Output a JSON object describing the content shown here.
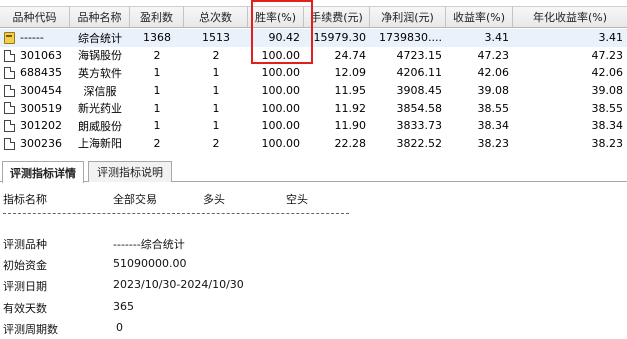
{
  "table": {
    "headers": [
      "品种代码",
      "品种名称",
      "盈利数",
      "总次数",
      "胜率(%)",
      "手续费(元)",
      "净利润(元)",
      "收益率(%)",
      "年化收益率(%)"
    ],
    "rows": [
      {
        "code": "------",
        "name": "综合统计",
        "profit_count": "1368",
        "total_count": "1513",
        "win_rate": "90.42",
        "fee": "15979.30",
        "net_profit": "1739830....",
        "return_rate": "3.41",
        "annual_return": "3.41",
        "icon": "folder-icon"
      },
      {
        "code": "301063",
        "name": "海锅股份",
        "profit_count": "2",
        "total_count": "2",
        "win_rate": "100.00",
        "fee": "24.74",
        "net_profit": "4723.15",
        "return_rate": "47.23",
        "annual_return": "47.23",
        "icon": "document-icon"
      },
      {
        "code": "688435",
        "name": "英方软件",
        "profit_count": "1",
        "total_count": "1",
        "win_rate": "100.00",
        "fee": "12.09",
        "net_profit": "4206.11",
        "return_rate": "42.06",
        "annual_return": "42.06",
        "icon": "document-icon"
      },
      {
        "code": "300454",
        "name": "深信服",
        "profit_count": "1",
        "total_count": "1",
        "win_rate": "100.00",
        "fee": "11.95",
        "net_profit": "3908.45",
        "return_rate": "39.08",
        "annual_return": "39.08",
        "icon": "document-icon"
      },
      {
        "code": "300519",
        "name": "新光药业",
        "profit_count": "1",
        "total_count": "1",
        "win_rate": "100.00",
        "fee": "11.92",
        "net_profit": "3854.58",
        "return_rate": "38.55",
        "annual_return": "38.55",
        "icon": "document-icon"
      },
      {
        "code": "301202",
        "name": "朗威股份",
        "profit_count": "1",
        "total_count": "1",
        "win_rate": "100.00",
        "fee": "11.90",
        "net_profit": "3833.73",
        "return_rate": "38.34",
        "annual_return": "38.34",
        "icon": "document-icon"
      },
      {
        "code": "300236",
        "name": "上海新阳",
        "profit_count": "2",
        "total_count": "2",
        "win_rate": "100.00",
        "fee": "22.28",
        "net_profit": "3822.52",
        "return_rate": "38.23",
        "annual_return": "38.23",
        "icon": "document-icon"
      }
    ],
    "highlight_color": "#e0201c"
  },
  "tabs": [
    {
      "label": "评测指标详情",
      "active": true
    },
    {
      "label": "评测指标说明",
      "active": false
    }
  ],
  "detail": {
    "header": {
      "label": "指标名称",
      "col_all": "全部交易",
      "col_long": "多头",
      "col_short": "空头"
    },
    "items": [
      {
        "label": "评测品种",
        "value": "-------综合统计"
      },
      {
        "label": "初始资金",
        "value": "51090000.00"
      },
      {
        "label": "评测日期",
        "value": "2023/10/30-2024/10/30"
      },
      {
        "label": "有效天数",
        "value": "365"
      },
      {
        "label": "评测周期数",
        "value": "0"
      }
    ]
  }
}
